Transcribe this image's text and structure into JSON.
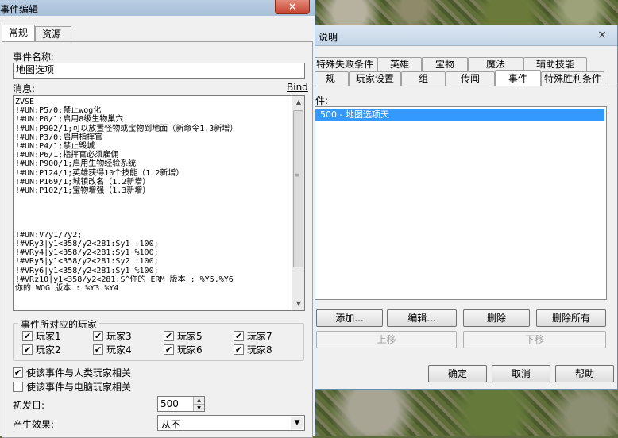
{
  "event_dialog": {
    "title": "事件编辑",
    "close_glyph": "×",
    "tabs": [
      {
        "label": "常规"
      },
      {
        "label": "资源"
      }
    ],
    "name_label": "事件名称:",
    "name_value": "地图选项",
    "message_label": "消息:",
    "bind_link": "Bind",
    "message_lines": [
      "ZVSE",
      "!#UN:P5/0;禁止wog化",
      "!#UN:P0/1;启用8级生物巢穴",
      "!#UN:P902/1;可以放置怪物或宝物到地面（新命令1.3新增）",
      "!#UN:P3/0;启用指挥官",
      "!#UN:P4/1;禁止毁城",
      "!#UN:P6/1;指挥官必须雇佣",
      "!#UN:P900/1;启用生物经验系统",
      "!#UN:P124/1;英雄获得10个技能（1.2新增）",
      "!#UN:P169/1;城镇改名（1.2新增）",
      "!#UN:P102/1;宝物增强（1.3新增）",
      "",
      "",
      "",
      "",
      "!#UN:V?y1/?y2;",
      "!#VRy3|y1<358/y2<281:Sy1 :100;",
      "!#VRy4|y1<358/y2<281:Sy1 %100;",
      "!#VRy5|y1<358/y2<281:Sy2 :100;",
      "!#VRy6|y1<358/y2<281:Sy1 %100;",
      "!#VRz10|y1<358/y2<281:S^你的 ERM 版本 : %Y5.%Y6",
      "你的 WOG 版本 : %Y3.%Y4"
    ],
    "players_group_label": "事件所对应的玩家",
    "players": [
      {
        "label": "玩家1",
        "checked": true
      },
      {
        "label": "玩家3",
        "checked": true
      },
      {
        "label": "玩家5",
        "checked": true
      },
      {
        "label": "玩家7",
        "checked": true
      },
      {
        "label": "玩家2",
        "checked": true
      },
      {
        "label": "玩家4",
        "checked": true
      },
      {
        "label": "玩家6",
        "checked": true
      },
      {
        "label": "玩家8",
        "checked": true
      }
    ],
    "human_option": {
      "label": "使该事件与人类玩家相关",
      "checked": true
    },
    "computer_option": {
      "label": "使该事件与电脑玩家相关",
      "checked": false
    },
    "first_day_label": "初发日:",
    "first_day_value": "500",
    "effect_label": "产生效果:",
    "effect_value": "从不",
    "check_glyph": "✔"
  },
  "map_dialog": {
    "title": "说明",
    "close_glyph": "×",
    "tabs_row1": [
      "特殊失败条件",
      "英雄",
      "宝物",
      "魔法",
      "辅助技能"
    ],
    "tabs_row2": [
      "规",
      "玩家设置",
      "组",
      "传闻",
      "事件",
      "特殊胜利条件"
    ],
    "active_tab": "事件",
    "list_label": "件:",
    "list_items": [
      "500 - 地图选项天"
    ],
    "buttons": {
      "add": "添加...",
      "edit": "编辑...",
      "delete": "删除",
      "delete_all": "删除所有",
      "move_up": "上移",
      "move_down": "下移",
      "ok": "确定",
      "cancel": "取消",
      "help": "帮助"
    }
  }
}
